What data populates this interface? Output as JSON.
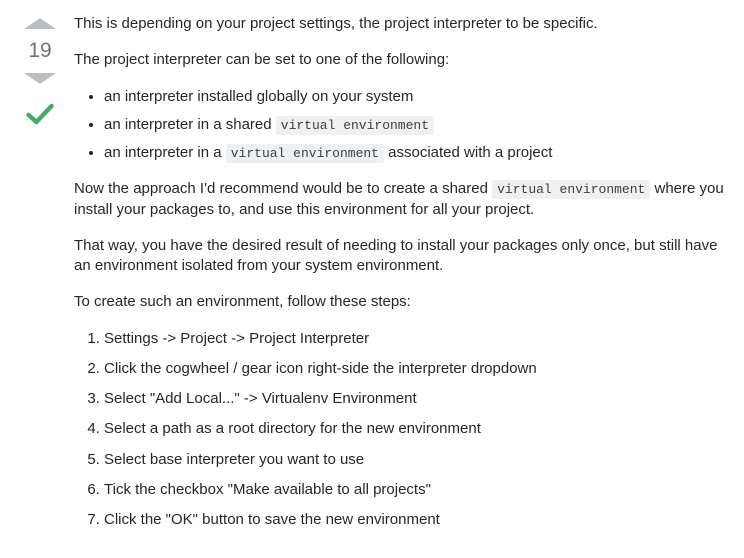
{
  "vote": {
    "count": "19"
  },
  "post": {
    "p1": "This is depending on your project settings, the project interpreter to be specific.",
    "p2": "The project interpreter can be set to one of the following:",
    "ul": {
      "li1": "an interpreter installed globally on your system",
      "li2_prefix": "an interpreter in a shared ",
      "li2_code": "virtual environment",
      "li3_prefix": "an interpreter in a ",
      "li3_code": "virtual environment",
      "li3_suffix": " associated with a project"
    },
    "p3_prefix": "Now the approach I'd recommend would be to create a shared ",
    "p3_code": "virtual environment",
    "p3_suffix": " where you install your packages to, and use this environment for all your project.",
    "p4": "That way, you have the desired result of needing to install your packages only once, but still have an environment isolated from your system environment.",
    "p5": "To create such an environment, follow these steps:",
    "ol": {
      "li1": "Settings -> Project -> Project Interpreter",
      "li2": "Click the cogwheel / gear icon right-side the interpreter dropdown",
      "li3": "Select \"Add Local...\" -> Virtualenv Environment",
      "li4": "Select a path as a root directory for the new environment",
      "li5": "Select base interpreter you want to use",
      "li6": "Tick the checkbox \"Make available to all projects\"",
      "li7": "Click the \"OK\" button to save the new environment"
    }
  }
}
